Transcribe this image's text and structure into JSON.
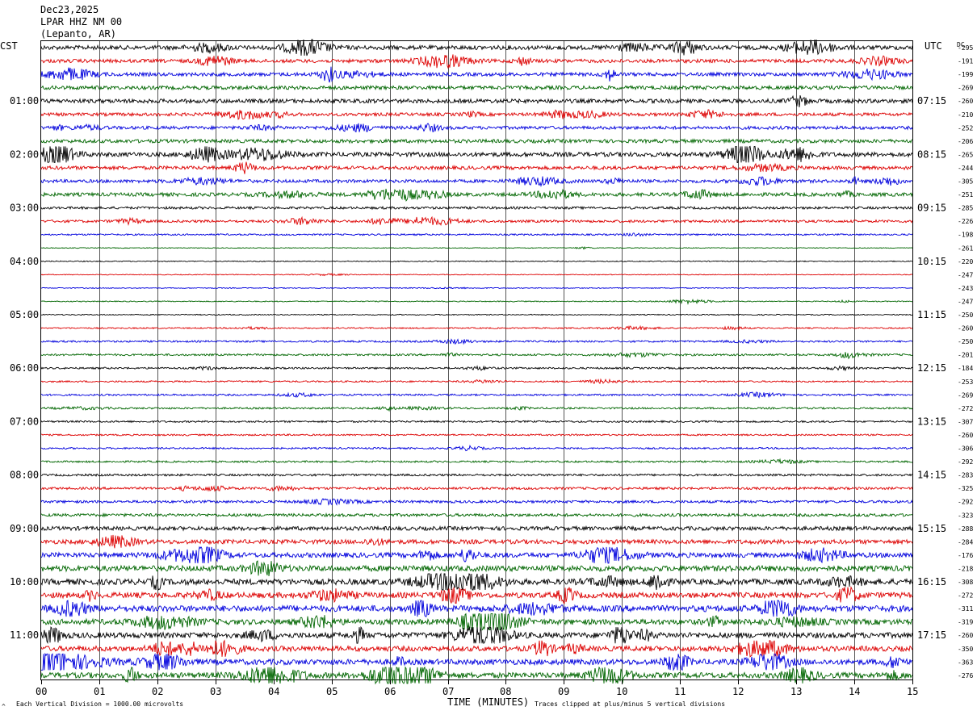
{
  "header": {
    "date": "Dec23,2025",
    "station": "LPAR HHZ NM 00",
    "location": "(Lepanto, AR)"
  },
  "left_tz": "CST",
  "right_tz": "UTC",
  "dc_label": "DC",
  "footer": {
    "scale": "Each Vertical Division = 1000.00 microvolts",
    "clip": "Traces clipped at plus/minus 5 vertical divisions",
    "glyph": "^"
  },
  "colors": {
    "cycle": [
      "#000000",
      "#dd0000",
      "#0000dd",
      "#006600"
    ]
  },
  "chart_data": {
    "type": "line",
    "xlabel": "TIME (MINUTES)",
    "xlim": [
      0,
      15
    ],
    "x_ticks": [
      "00",
      "01",
      "02",
      "03",
      "04",
      "05",
      "06",
      "07",
      "08",
      "09",
      "10",
      "11",
      "12",
      "13",
      "14",
      "15"
    ],
    "left_hour_labels": [
      "01:00",
      "02:00",
      "03:00",
      "04:00",
      "05:00",
      "06:00",
      "07:00",
      "08:00",
      "09:00",
      "10:00",
      "11:00"
    ],
    "right_hour_labels": [
      "07:15",
      "08:15",
      "09:15",
      "10:15",
      "11:15",
      "12:15",
      "13:15",
      "14:15",
      "15:15",
      "16:15",
      "17:15"
    ],
    "dc_offsets": [
      -295,
      -191,
      -199,
      -269,
      -260,
      -210,
      -252,
      -206,
      -265,
      -244,
      -305,
      -251,
      -285,
      -226,
      -198,
      -261,
      -220,
      -247,
      -243,
      -247,
      -250,
      -260,
      -250,
      -201,
      -184,
      -253,
      -269,
      -272,
      -307,
      -260,
      -306,
      -292,
      -283,
      -325,
      -292,
      -323,
      -288,
      -284,
      -176,
      -218,
      -308,
      -272,
      -311,
      -319,
      -260,
      -350,
      -363,
      -276
    ],
    "activity": [
      2.6,
      2.2,
      2.2,
      2.3,
      2.5,
      2.0,
      2.0,
      2.2,
      2.7,
      2.2,
      2.0,
      2.2,
      1.5,
      1.6,
      1.0,
      0.5,
      0.6,
      0.5,
      0.5,
      0.6,
      0.6,
      0.8,
      1.1,
      1.2,
      1.1,
      1.0,
      1.1,
      1.1,
      1.1,
      1.0,
      1.0,
      1.1,
      1.3,
      1.5,
      1.6,
      1.8,
      2.4,
      2.7,
      3.0,
      3.5,
      3.6,
      3.4,
      3.8,
      3.4,
      3.4,
      3.2,
      3.4,
      3.4
    ]
  }
}
